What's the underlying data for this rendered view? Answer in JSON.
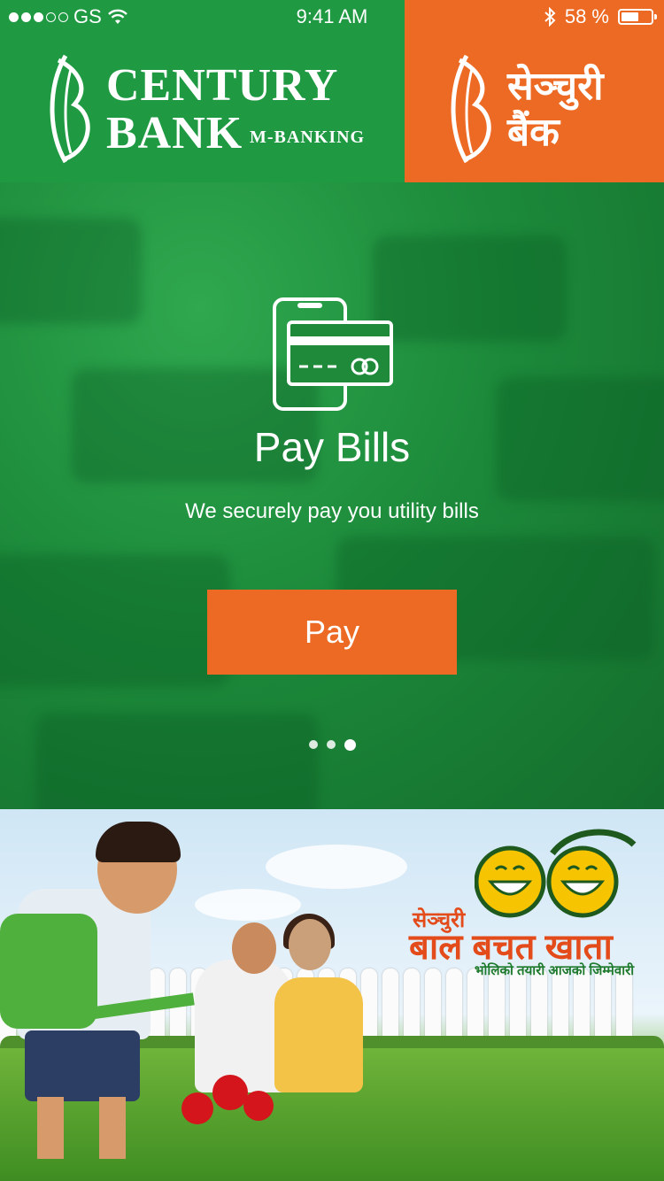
{
  "status_bar": {
    "carrier": "GS",
    "time": "9:41 AM",
    "battery_percent": "58 %",
    "battery_level": 0.58,
    "signal_bars_filled": 3,
    "signal_bars_total": 5
  },
  "header": {
    "brand_line1": "CENTURY",
    "brand_line2": "BANK",
    "brand_sub": "M-BANKING",
    "brand_np_line1": "सेञ्चुरी",
    "brand_np_line2": "बैंक"
  },
  "hero": {
    "icon": "pay-bills-icon",
    "title": "Pay Bills",
    "subtitle": "We securely pay you utility bills",
    "button_label": "Pay",
    "pager": {
      "count": 3,
      "active_index": 2
    }
  },
  "banner": {
    "promo_brand": "सेञ्चुरी",
    "promo_title": "बाल बचत खाता",
    "promo_tagline": "भोलिको तयारी आजको जिम्मेवारी"
  },
  "colors": {
    "green": "#1f9a43",
    "orange": "#ec6a23"
  }
}
